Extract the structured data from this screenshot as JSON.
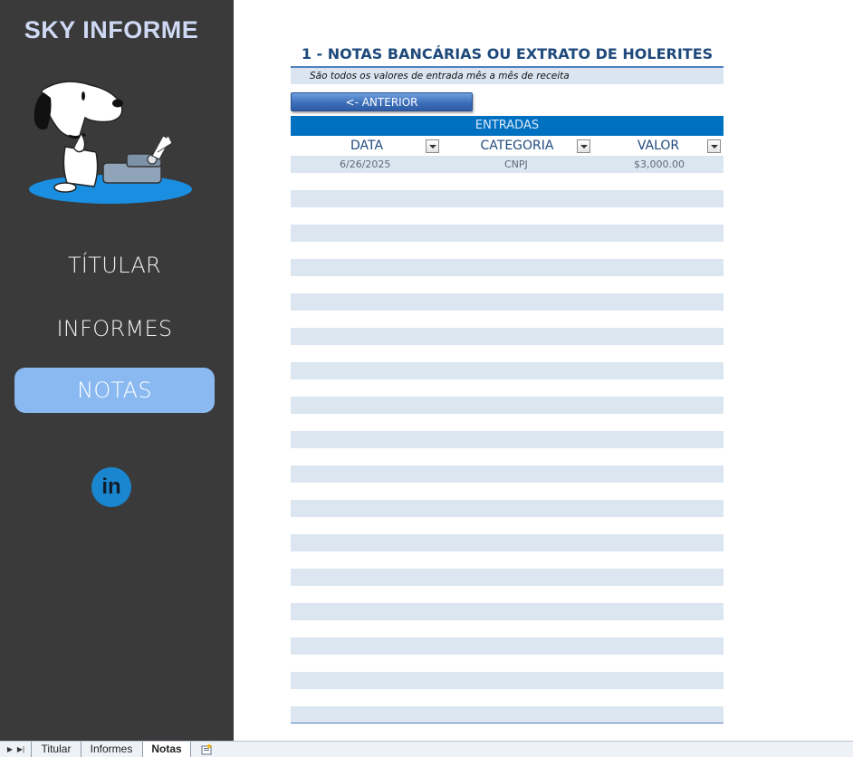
{
  "sidebar": {
    "brand": "SKY INFORME",
    "nav": [
      {
        "label": "TÍTULAR",
        "active": false
      },
      {
        "label": "INFORMES",
        "active": false
      },
      {
        "label": "NOTAS",
        "active": true
      }
    ],
    "linkedin_label": "in",
    "icons": [
      "snoopy-typewriter-image",
      "linkedin-icon"
    ]
  },
  "sheet": {
    "title": "1 - NOTAS BANCÁRIAS OU EXTRATO DE HOLERITES",
    "subtitle": "São todos os valores de entrada mês a mês de receita",
    "prev_button": "<- ANTERIOR",
    "table_banner": "ENTRADAS",
    "columns": [
      "DATA",
      "CATEGORIA",
      "VALOR"
    ],
    "rows": [
      {
        "date": "6/26/2025",
        "category": "CNPJ",
        "value": "$3,000.00"
      }
    ]
  },
  "tabs": {
    "items": [
      {
        "label": "Titular",
        "active": false
      },
      {
        "label": "Informes",
        "active": false
      },
      {
        "label": "Notas",
        "active": true
      }
    ]
  },
  "colors": {
    "sidebar_bg": "#3a3a3a",
    "nav_active": "#8ab9f1",
    "banner_blue": "#0070c0",
    "title_blue": "#1f4a7c",
    "band_row": "#dce6f0"
  }
}
